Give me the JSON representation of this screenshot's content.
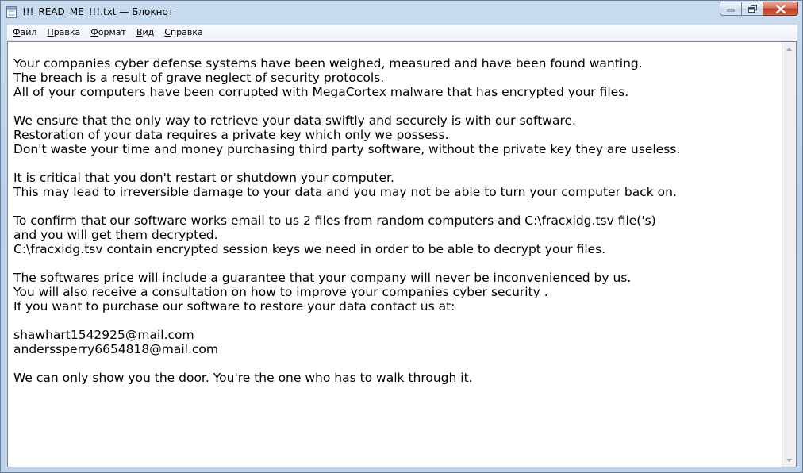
{
  "window": {
    "title": "!!!_READ_ME_!!!.txt — Блокнот",
    "icons": {
      "app": "notepad-icon",
      "minimize": "minimize-icon",
      "maximize": "maximize-icon",
      "close": "close-icon"
    }
  },
  "menu": {
    "items": [
      {
        "underlined": "Ф",
        "rest": "айл"
      },
      {
        "underlined": "П",
        "rest": "равка"
      },
      {
        "underlined": "Ф",
        "rest": "ормат",
        "prefix": ""
      },
      {
        "underlined": "В",
        "rest": "ид"
      },
      {
        "underlined": "С",
        "rest": "правка"
      }
    ]
  },
  "document": {
    "lines": [
      "Your companies cyber defense systems have been weighed, measured and have been found wanting.",
      "The breach is a result of grave neglect of security protocols.",
      "All of your computers have been corrupted with MegaCortex malware that has encrypted your files.",
      "",
      "We ensure that the only way to retrieve your data swiftly and securely is with our software.",
      "Restoration of your data requires a private key which only we possess.",
      "Don't waste your time and money purchasing third party software, without the private key they are useless.",
      "",
      "It is critical that you don't restart or shutdown your computer.",
      "This may lead to irreversible damage to your data and you may not be able to turn your computer back on.",
      "",
      "To confirm that our software works email to us 2 files from random computers and C:\\fracxidg.tsv file('s)",
      "and you will get them decrypted.",
      "C:\\fracxidg.tsv contain encrypted session keys we need in order to be able to decrypt your files.",
      "",
      "The softwares price will include a guarantee that your company will never be inconvenienced by us.",
      "You will also receive a consultation on how to improve your companies cyber security .",
      "If you want to purchase our software to restore your data contact us at:",
      "",
      "shawhart1542925@mail.com",
      "anderssperry6654818@mail.com",
      "",
      "We can only show you the door. You're the one who has to walk through it."
    ]
  },
  "scrollbar": {
    "up_icon": "scroll-up-arrow-icon",
    "down_icon": "scroll-down-arrow-icon"
  }
}
